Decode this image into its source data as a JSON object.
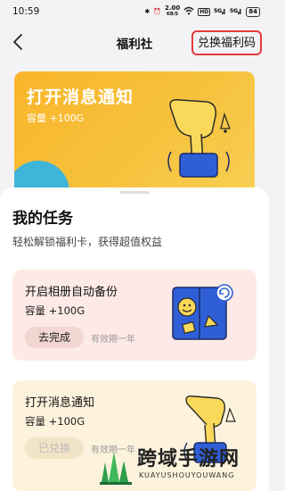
{
  "status_bar": {
    "time": "10:59",
    "net_speed": "2.00",
    "net_unit": "KB/S",
    "battery": "84",
    "icons": [
      "bluetooth-icon",
      "alarm-icon",
      "wifi-icon",
      "hd-icon",
      "signal-5g-icon",
      "signal-5g-icon"
    ]
  },
  "nav": {
    "back_icon": "chevron-left-icon",
    "title": "福利社",
    "redeem_label": "兑换福利码"
  },
  "banner": {
    "title": "打开消息通知",
    "subtitle": "容量 +100G",
    "bg_color": "#f9b52a"
  },
  "tasks": {
    "title": "我的任务",
    "subtitle": "轻松解锁福利卡，获得超值权益",
    "items": [
      {
        "title": "开启相册自动备份",
        "capacity": "容量 +100G",
        "button": "去完成",
        "validity": "有效期一年",
        "bg_color": "#fdeae6"
      },
      {
        "title": "打开消息通知",
        "capacity": "容量 +100G",
        "button": "已兑换",
        "validity": "有效期一年",
        "bg_color": "#fdf3dc"
      }
    ]
  },
  "watermark": {
    "text": "跨域手游网",
    "sub": "KUAYUSHOUYOUWANG"
  },
  "colors": {
    "highlight_border": "#e53b3b",
    "accent_blue": "#2f5fd6"
  }
}
